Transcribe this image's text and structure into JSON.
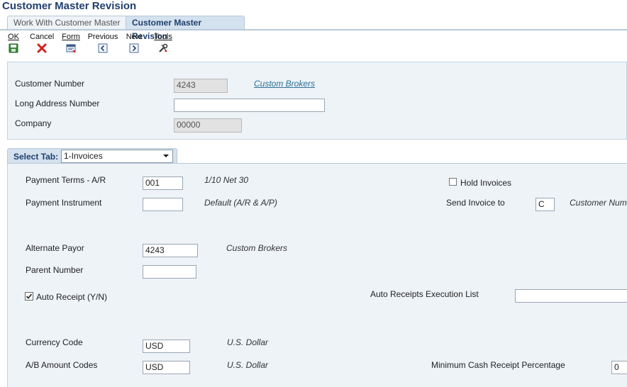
{
  "window": {
    "title": "Customer Master Revision"
  },
  "tabs": [
    {
      "label": "Work With Customer Master"
    },
    {
      "label": "Customer Master Revision"
    }
  ],
  "toolbar": {
    "ok": "OK",
    "cancel": "Cancel",
    "form": "Form",
    "previous": "Previous",
    "next": "Next",
    "tools": "Tools"
  },
  "header": {
    "customer_number_label": "Customer Number",
    "customer_number_value": "4243",
    "customer_name": "Custom Brokers",
    "long_address_label": "Long Address Number",
    "long_address_value": "",
    "company_label": "Company",
    "company_value": "00000"
  },
  "select_tab": {
    "label": "Select Tab:",
    "value": "1-Invoices"
  },
  "invoices": {
    "payment_terms_label": "Payment Terms - A/R",
    "payment_terms_value": "001",
    "payment_terms_desc": "1/10 Net 30",
    "hold_invoices_label": "Hold Invoices",
    "hold_invoices_checked": false,
    "payment_instrument_label": "Payment Instrument",
    "payment_instrument_value": "",
    "payment_instrument_desc": "Default (A/R & A/P)",
    "send_invoice_label": "Send Invoice to",
    "send_invoice_value": "C",
    "send_invoice_desc": "Customer Num",
    "alternate_payor_label": "Alternate Payor",
    "alternate_payor_value": "4243",
    "alternate_payor_desc": "Custom Brokers",
    "parent_number_label": "Parent Number",
    "parent_number_value": "",
    "auto_receipt_label": "Auto Receipt (Y/N)",
    "auto_receipt_checked": true,
    "auto_receipts_exec_label": "Auto Receipts Execution List",
    "auto_receipts_exec_value": "",
    "currency_code_label": "Currency Code",
    "currency_code_value": "USD",
    "currency_code_desc": "U.S. Dollar",
    "ab_amount_codes_label": "A/B Amount Codes",
    "ab_amount_codes_value": "USD",
    "ab_amount_codes_desc": "U.S. Dollar",
    "min_cash_receipt_label": "Minimum Cash Receipt Percentage",
    "min_cash_receipt_value": "0"
  },
  "colors": {
    "title": "#1f3f6e",
    "panel": "#eef3f8",
    "link": "#2a6f96",
    "cancel_icon": "#d42020"
  },
  "icons": [
    "save-icon",
    "cancel-x-icon",
    "form-icon",
    "previous-arrow-icon",
    "next-arrow-icon",
    "tools-icon",
    "dropdown-arrow-icon",
    "checkbox-icon"
  ]
}
